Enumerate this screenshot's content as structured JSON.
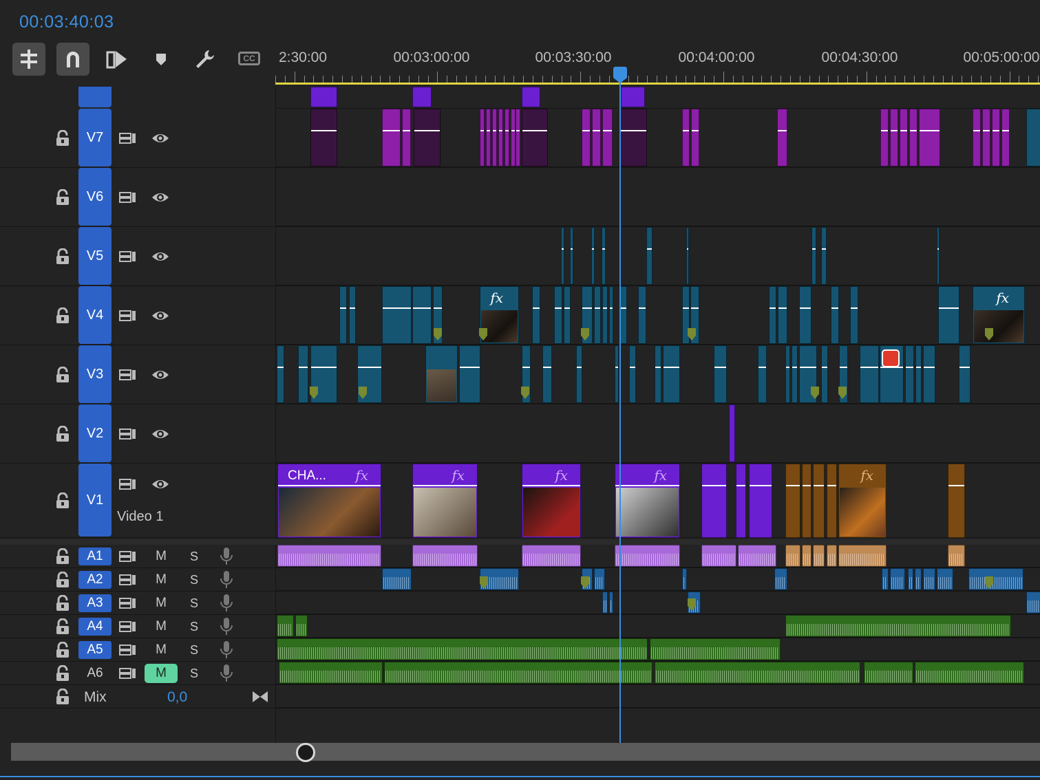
{
  "timecode": "00:03:40:03",
  "toolbar": {
    "tools": [
      "insert-sequence-icon",
      "snap-icon",
      "linked-selection-icon",
      "add-marker-icon",
      "settings-wrench-icon",
      "captions-icon"
    ],
    "captions_label": "CC"
  },
  "ruler": {
    "labels": [
      "2:30:00",
      "00:03:00:00",
      "00:03:30:00",
      "00:04:00:00",
      "00:04:30:00",
      "00:05:00:00"
    ]
  },
  "video_tracks": [
    {
      "id": "V7",
      "label": "V7"
    },
    {
      "id": "V6",
      "label": "V6"
    },
    {
      "id": "V5",
      "label": "V5"
    },
    {
      "id": "V4",
      "label": "V4"
    },
    {
      "id": "V3",
      "label": "V3"
    },
    {
      "id": "V2",
      "label": "V2"
    },
    {
      "id": "V1",
      "label": "V1",
      "name": "Video 1"
    }
  ],
  "audio_tracks": [
    {
      "id": "A1",
      "label": "A1",
      "targeted": true,
      "mute": "M",
      "solo": "S",
      "muted": false
    },
    {
      "id": "A2",
      "label": "A2",
      "targeted": true,
      "mute": "M",
      "solo": "S",
      "muted": false
    },
    {
      "id": "A3",
      "label": "A3",
      "targeted": true,
      "mute": "M",
      "solo": "S",
      "muted": false
    },
    {
      "id": "A4",
      "label": "A4",
      "targeted": true,
      "mute": "M",
      "solo": "S",
      "muted": false
    },
    {
      "id": "A5",
      "label": "A5",
      "targeted": true,
      "mute": "M",
      "solo": "S",
      "muted": false
    },
    {
      "id": "A6",
      "label": "A6",
      "targeted": false,
      "mute": "M",
      "solo": "S",
      "muted": true
    }
  ],
  "mix": {
    "label": "Mix",
    "value": "0,0"
  },
  "v1_clips": {
    "first_title": "CHA...",
    "fx": "fx"
  },
  "colors": {
    "accent": "#3b8fe0",
    "track_tag": "#2d62c8",
    "v1_clip": "#6a1fd0",
    "v7_clip": "#8e1fa8",
    "v3v4_clip": "#155572",
    "audio_green": "#2f6e1c",
    "mute_active": "#5fd4a0",
    "work_area": "#e1d640"
  }
}
